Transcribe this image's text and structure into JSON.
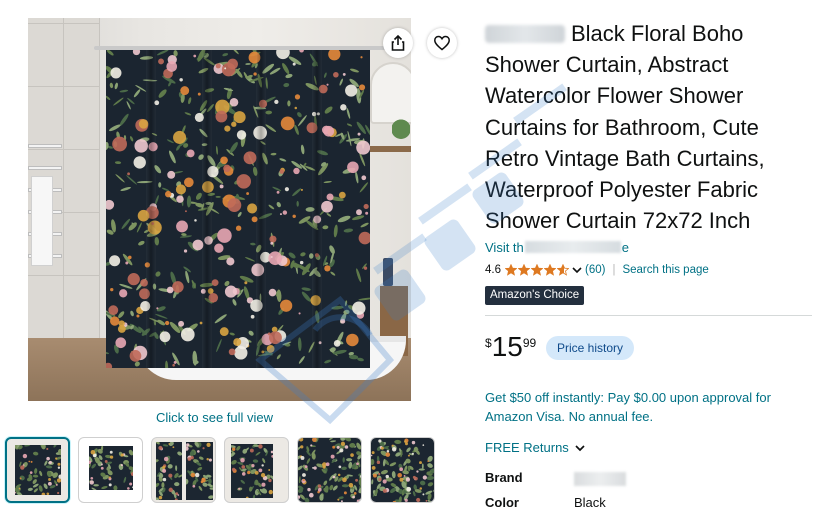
{
  "product": {
    "title": "Black Floral Boho Shower Curtain, Abstract Watercolor Flower Shower Curtains for Bathroom, Cute Retro Vintage Bath Curtains, Waterproof Polyester Fabric Shower Curtain 72x72 Inch",
    "visit_prefix": "Visit th",
    "visit_suffix": "e",
    "rating_value": "4.6",
    "rating_stars": 4.6,
    "review_count": "(60)",
    "search_page_label": "Search this page",
    "badge": "Amazon's Choice",
    "price_symbol": "$",
    "price_whole": "15",
    "price_fraction": "99",
    "price_history_label": "Price history",
    "promo_text": "Get $50 off instantly: Pay $0.00 upon approval for Amazon Visa. No annual fee.",
    "returns_label": "FREE Returns",
    "specs": [
      {
        "key": "Brand",
        "value": ""
      },
      {
        "key": "Color",
        "value": "Black"
      }
    ]
  },
  "gallery": {
    "full_view_label": "Click to see full view",
    "thumbnail_count": 6,
    "active_thumbnail": 0
  },
  "icons": {
    "share": "share-icon",
    "favorite": "heart-icon",
    "returns_dropdown": "chevron-down-icon",
    "rating_dropdown": "chevron-down-icon"
  },
  "colors": {
    "link": "#007185",
    "star": "#de7921",
    "badge_bg": "#232f3e",
    "price_history_bg": "#d4e8fa",
    "curtain_bg": "#1b2530"
  }
}
